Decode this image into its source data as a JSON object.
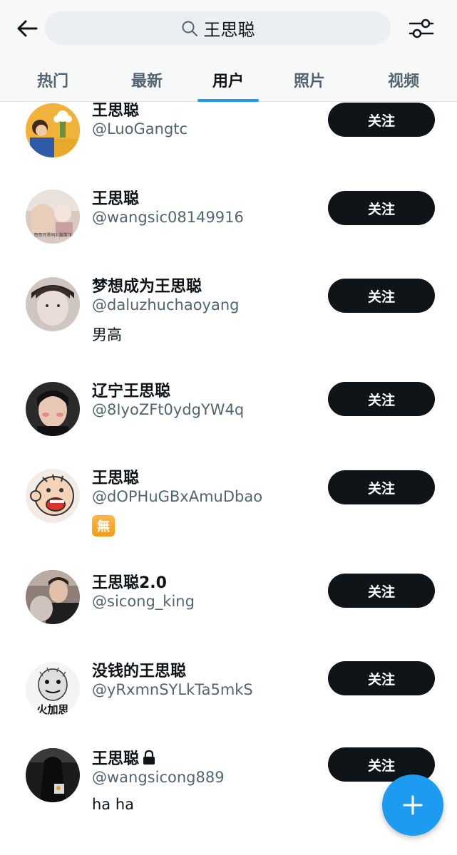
{
  "search": {
    "query": "王思聪"
  },
  "tabs": [
    {
      "label": "热门"
    },
    {
      "label": "最新"
    },
    {
      "label": "用户",
      "active": true
    },
    {
      "label": "照片"
    },
    {
      "label": "视频"
    }
  ],
  "users": [
    {
      "name": "王思聪",
      "handle": "@LuoGangtc",
      "bio": "",
      "follow_label": "关注"
    },
    {
      "name": "王思聪",
      "handle": "@wangsic08149916",
      "bio": "",
      "follow_label": "关注"
    },
    {
      "name": "梦想成为王思聪",
      "handle": "@daluzhuchaoyang",
      "bio": "男高",
      "follow_label": "关注"
    },
    {
      "name": "辽宁王思聪",
      "handle": "@8IyoZFt0ydgYW4q",
      "bio": "",
      "follow_label": "关注"
    },
    {
      "name": "王思聪",
      "handle": "@dOPHuGBxAmuDbao",
      "bio": "無",
      "follow_label": "关注"
    },
    {
      "name": "王思聪2.0",
      "handle": "@sicong_king",
      "bio": "",
      "follow_label": "关注"
    },
    {
      "name": "没钱的王思聪",
      "handle": "@yRxmnSYLkTa5mkS",
      "bio": "",
      "follow_label": "关注"
    },
    {
      "name": "王思聪",
      "handle": "@wangsicong889",
      "bio": "ha ha",
      "follow_label": "关注",
      "locked": true
    }
  ],
  "avatar_thumbnail_text": {
    "user_2": "哥哥开黑吗? 我带飞",
    "user_7": "火加思"
  },
  "colors": {
    "accent": "#1d9bf0",
    "follow_button": "#0f1419",
    "secondary_text": "#536471"
  },
  "icons": [
    "back-arrow-icon",
    "search-icon",
    "filter-sliders-icon",
    "lock-icon",
    "plus-icon"
  ]
}
